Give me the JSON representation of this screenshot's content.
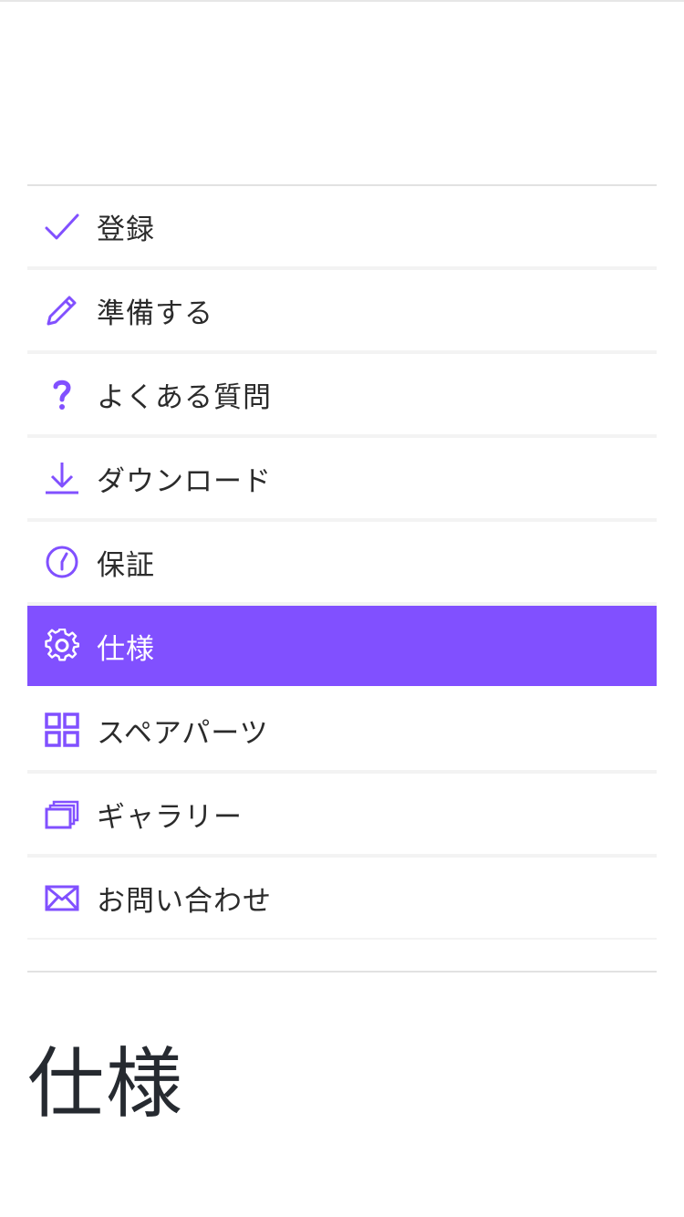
{
  "colors": {
    "accent": "#8150ff",
    "text": "#2b2b2b",
    "active_text": "#ffffff",
    "divider": "#e2e2e2"
  },
  "menu": {
    "items": [
      {
        "label": "登録",
        "icon": "check-icon",
        "active": false
      },
      {
        "label": "準備する",
        "icon": "pencil-icon",
        "active": false
      },
      {
        "label": "よくある質問",
        "icon": "question-icon",
        "active": false
      },
      {
        "label": "ダウンロード",
        "icon": "download-icon",
        "active": false
      },
      {
        "label": "保証",
        "icon": "clock-icon",
        "active": false
      },
      {
        "label": "仕様",
        "icon": "gear-icon",
        "active": true
      },
      {
        "label": "スペアパーツ",
        "icon": "grid-icon",
        "active": false
      },
      {
        "label": "ギャラリー",
        "icon": "gallery-icon",
        "active": false
      },
      {
        "label": "お問い合わせ",
        "icon": "mail-icon",
        "active": false
      }
    ]
  },
  "page": {
    "title": "仕様"
  }
}
